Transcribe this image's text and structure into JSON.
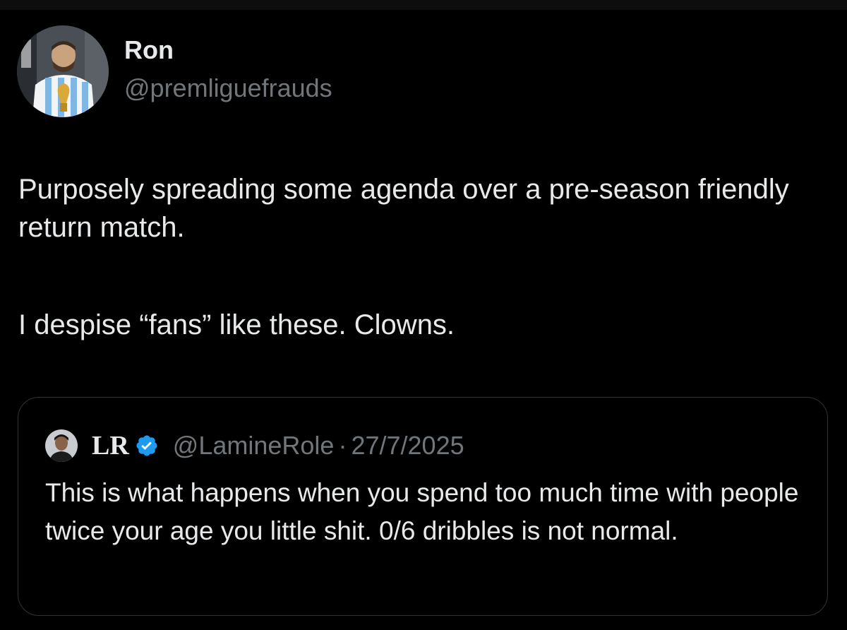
{
  "tweet": {
    "author": {
      "display_name": "Ron",
      "handle": "@premliguefrauds",
      "avatar_icon": "avatar-photo"
    },
    "paragraphs": [
      "Purposely spreading some agenda over a pre-season friendly return match.",
      "I despise “fans” like these. Clowns."
    ]
  },
  "quote": {
    "author": {
      "display_name": "LR",
      "verified": true,
      "handle": "@LamineRole",
      "separator": "·",
      "date": "27/7/2025"
    },
    "text": "This is what happens when you spend too much time with people twice your age you little shit. 0/6 dribbles is not normal."
  },
  "colors": {
    "background": "#000000",
    "primary_text": "#e7e9ea",
    "secondary_text": "#71767b",
    "border": "#2f3336",
    "verified_badge": "#1d9bf0"
  }
}
